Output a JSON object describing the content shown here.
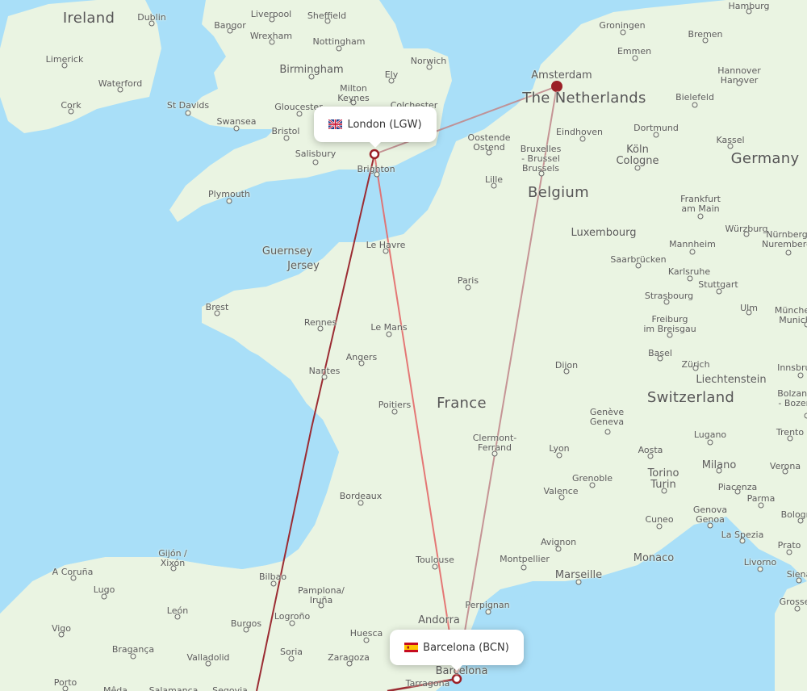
{
  "map": {
    "colors": {
      "water": "#a9dff8",
      "land": "#eaf4e2",
      "route_dark": "#9b2c33",
      "route_light": "#e46a6a",
      "route_pale": "#c28a8d",
      "marker": "#9b2027"
    },
    "airports": {
      "origin": {
        "label": "London (LGW)",
        "flag": "uk-flag-icon"
      },
      "destination": {
        "label": "Barcelona (BCN)",
        "flag": "spain-flag-icon"
      },
      "hub": {
        "name": "Amsterdam"
      }
    },
    "routes": [
      {
        "from": "London (LGW)",
        "to": "Barcelona (BCN)",
        "style": "direct"
      },
      {
        "from": "London (LGW)",
        "to": "Amsterdam",
        "style": "connection"
      },
      {
        "from": "Amsterdam",
        "to": "Barcelona (BCN)",
        "style": "connection"
      },
      {
        "from": "London (LGW)",
        "to": "Southwest (off-map)",
        "style": "dark"
      }
    ],
    "countries": [
      "Ireland",
      "The Netherlands",
      "Belgium",
      "Germany",
      "Luxembourg",
      "France",
      "Switzerland",
      "Liechtenstein",
      "Monaco",
      "Andorra",
      "Guernsey",
      "Jersey"
    ],
    "cities": [
      "Dublin",
      "Limerick",
      "Waterford",
      "Cork",
      "Bangor",
      "Liverpool",
      "Sheffield",
      "Wrexham",
      "Nottingham",
      "Birmingham",
      "Norwich",
      "Ely",
      "Milton Keynes",
      "Gloucester",
      "Colchester",
      "St Davids",
      "Swansea",
      "Bristol",
      "Salisbury",
      "Brighton",
      "Plymouth",
      "Oostende Ostend",
      "Groningen",
      "Emmen",
      "Bremen",
      "Hamburg",
      "Hannover Hanover",
      "Bielefeld",
      "Amsterdam",
      "Eindhoven",
      "Dortmund",
      "Köln Cologne",
      "Kassel",
      "Bruxelles - Brussel Brussels",
      "Lille",
      "Frankfurt am Main",
      "Würzburg",
      "Mannheim",
      "Nürnberg Nuremberg",
      "Saarbrücken",
      "Karlsruhe",
      "Stuttgart",
      "Strasbourg",
      "Ulm",
      "München Munich",
      "Freiburg im Breisgau",
      "Basel",
      "Zürich",
      "Innsbruck",
      "Le Havre",
      "Paris",
      "Brest",
      "Rennes",
      "Le Mans",
      "Angers",
      "Nantes",
      "Poitiers",
      "Dijon",
      "Genève Geneva",
      "Bolzano - Bozen",
      "Trento",
      "Lugano",
      "Aosta",
      "Milano",
      "Verona",
      "Lyon",
      "Clermont-Ferrand",
      "Torino Turin",
      "Grenoble",
      "Valence",
      "Piacenza",
      "Parma",
      "Bologna",
      "Bordeaux",
      "Genova Genoa",
      "La Spezia",
      "Cuneo",
      "Prato",
      "Avignon",
      "Livorno",
      "Montpellier",
      "Marseille",
      "Siena",
      "Toulouse",
      "Grosseto",
      "Perpignan",
      "Gijón / Xixón",
      "A Coruña",
      "Lugo",
      "Bilbao",
      "Pamplona/ Iruña",
      "León",
      "Vigo",
      "Burgos",
      "Logroño",
      "Huesca",
      "Bragança",
      "Valladolid",
      "Soria",
      "Zaragoza",
      "Porto",
      "Mêda",
      "Salamanca",
      "Segovia",
      "Tarragona",
      "Barcelona"
    ]
  }
}
